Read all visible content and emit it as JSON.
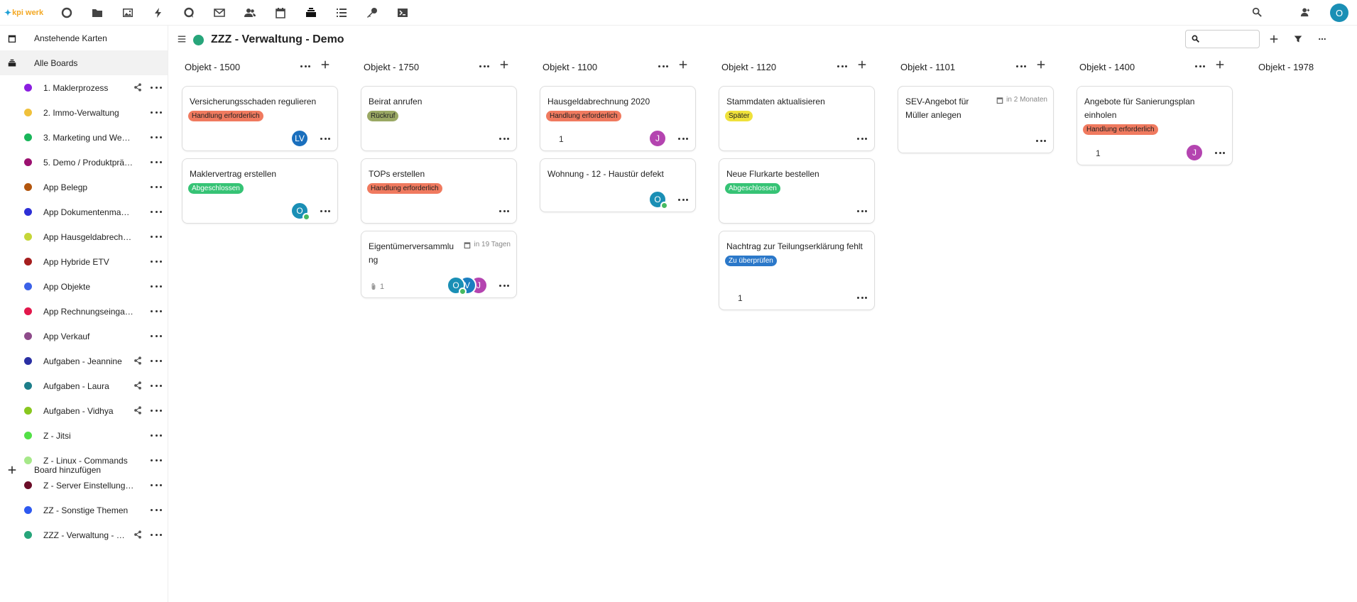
{
  "app": {
    "logo_text": "kpi werk",
    "user_initial": "O",
    "accent": "#1a8fb5"
  },
  "topnav": {
    "icons": [
      "dashboard-icon",
      "files-icon",
      "photos-icon",
      "activity-icon",
      "talk-icon",
      "mail-icon",
      "contacts-icon",
      "calendar-icon",
      "deck-icon",
      "tasks-icon",
      "passwords-icon",
      "terminal-icon"
    ],
    "right_icons": [
      "search-icon",
      "contacts-menu-icon"
    ]
  },
  "sidebar": {
    "upcoming_label": "Anstehende Karten",
    "all_boards_label": "Alle Boards",
    "add_board_label": "Board hinzufügen",
    "boards": [
      {
        "label": "1. Maklerprozess",
        "color": "#8b1ee0",
        "shared": true
      },
      {
        "label": "2. Immo-Verwaltung",
        "color": "#f0c13b",
        "shared": false
      },
      {
        "label": "3. Marketing und Web…",
        "color": "#19b65a",
        "shared": false
      },
      {
        "label": "5. Demo / Produktprä…",
        "color": "#9c1170",
        "shared": false
      },
      {
        "label": "App Belegp",
        "color": "#b3560e",
        "shared": false
      },
      {
        "label": "App Dokumentenman…",
        "color": "#2d2fd6",
        "shared": false
      },
      {
        "label": "App Hausgeldabrechn…",
        "color": "#c5d638",
        "shared": false
      },
      {
        "label": "App Hybride ETV",
        "color": "#a51e1e",
        "shared": false
      },
      {
        "label": "App Objekte",
        "color": "#3b62e8",
        "shared": false
      },
      {
        "label": "App Rechnungseingang",
        "color": "#e2174b",
        "shared": false
      },
      {
        "label": "App Verkauf",
        "color": "#8e4b8a",
        "shared": false
      },
      {
        "label": "Aufgaben - Jeannine",
        "color": "#2a2fa3",
        "shared": true
      },
      {
        "label": "Aufgaben - Laura",
        "color": "#1d7e8a",
        "shared": true
      },
      {
        "label": "Aufgaben - Vidhya",
        "color": "#88c71f",
        "shared": true
      },
      {
        "label": "Z - Jitsi",
        "color": "#52e046",
        "shared": false
      },
      {
        "label": "Z - Linux - Commands",
        "color": "#a6e889",
        "shared": false
      },
      {
        "label": "Z - Server Einstellunge…",
        "color": "#6b0d28",
        "shared": false
      },
      {
        "label": "ZZ - Sonstige Themen",
        "color": "#2e59f0",
        "shared": false
      },
      {
        "label": "ZZZ - Verwaltung - …",
        "color": "#27a57a",
        "shared": true
      }
    ]
  },
  "board": {
    "title": "ZZZ - Verwaltung - Demo",
    "color": "#27a57a",
    "search_placeholder": ""
  },
  "stacks": [
    {
      "title": "Objekt - 1500",
      "cards": [
        {
          "title": "Versicherungsschaden regulieren",
          "label": "Handlung erforderlich",
          "label_color": "#f07a5f",
          "label_light": false,
          "avatars": [
            {
              "initial": "LV",
              "color": "#1a6fbd",
              "status": false
            }
          ]
        },
        {
          "title": "Maklervertrag erstellen",
          "label": "Abgeschlossen",
          "label_color": "#36c375",
          "label_light": true,
          "avatars": [
            {
              "initial": "O",
              "color": "#1a8fb5",
              "status": true
            }
          ]
        }
      ]
    },
    {
      "title": "Objekt - 1750",
      "cards": [
        {
          "title": "Beirat anrufen",
          "label": "Rückruf",
          "label_color": "#9aa864",
          "label_light": false,
          "avatars": []
        },
        {
          "title": "TOPs erstellen",
          "label": "Handlung erforderlich",
          "label_color": "#f07a5f",
          "label_light": false,
          "avatars": []
        },
        {
          "title": "Eigentümerversammlu ng",
          "label": "",
          "due": "in 19 Tagen",
          "attachments": "1",
          "avatars": [
            {
              "initial": "O",
              "color": "#1a8fb5",
              "status": true
            },
            {
              "initial": "V",
              "color": "#1a7ec0",
              "status": false
            },
            {
              "initial": "J",
              "color": "#b444b0",
              "status": false
            }
          ]
        }
      ]
    },
    {
      "title": "Objekt - 1100",
      "cards": [
        {
          "title": "Hausgeldabrechnung 2020",
          "label": "Handlung erforderlich",
          "label_color": "#f07a5f",
          "label_light": false,
          "count": "1",
          "avatars": [
            {
              "initial": "J",
              "color": "#b444b0",
              "status": false
            }
          ]
        },
        {
          "title": "Wohnung - 12 - Haustür defekt",
          "label": "",
          "avatars": [
            {
              "initial": "O",
              "color": "#1a8fb5",
              "status": true
            }
          ]
        }
      ]
    },
    {
      "title": "Objekt - 1120",
      "cards": [
        {
          "title": "Stammdaten aktualisieren",
          "label": "Später",
          "label_color": "#efe13b",
          "label_light": false,
          "avatars": []
        },
        {
          "title": "Neue Flurkarte bestellen",
          "label": "Abgeschlossen",
          "label_color": "#36c375",
          "label_light": true,
          "avatars": []
        },
        {
          "title": "Nachtrag zur Teilungserklärung fehlt",
          "label": "Zu überprüfen",
          "label_color": "#2b78c9",
          "label_light": true,
          "count": "1",
          "avatars": []
        }
      ]
    },
    {
      "title": "Objekt - 1101",
      "cards": [
        {
          "title": "SEV-Angebot für Müller anlegen",
          "label": "",
          "due": "in 2 Monaten",
          "avatars": []
        }
      ]
    },
    {
      "title": "Objekt - 1400",
      "cards": [
        {
          "title": "Angebote für Sanierungsplan einholen",
          "label": "Handlung erforderlich",
          "label_color": "#f07a5f",
          "label_light": false,
          "count": "1",
          "avatars": [
            {
              "initial": "J",
              "color": "#b444b0",
              "status": false
            }
          ]
        }
      ]
    },
    {
      "title": "Objekt - 1978",
      "cards": []
    }
  ]
}
